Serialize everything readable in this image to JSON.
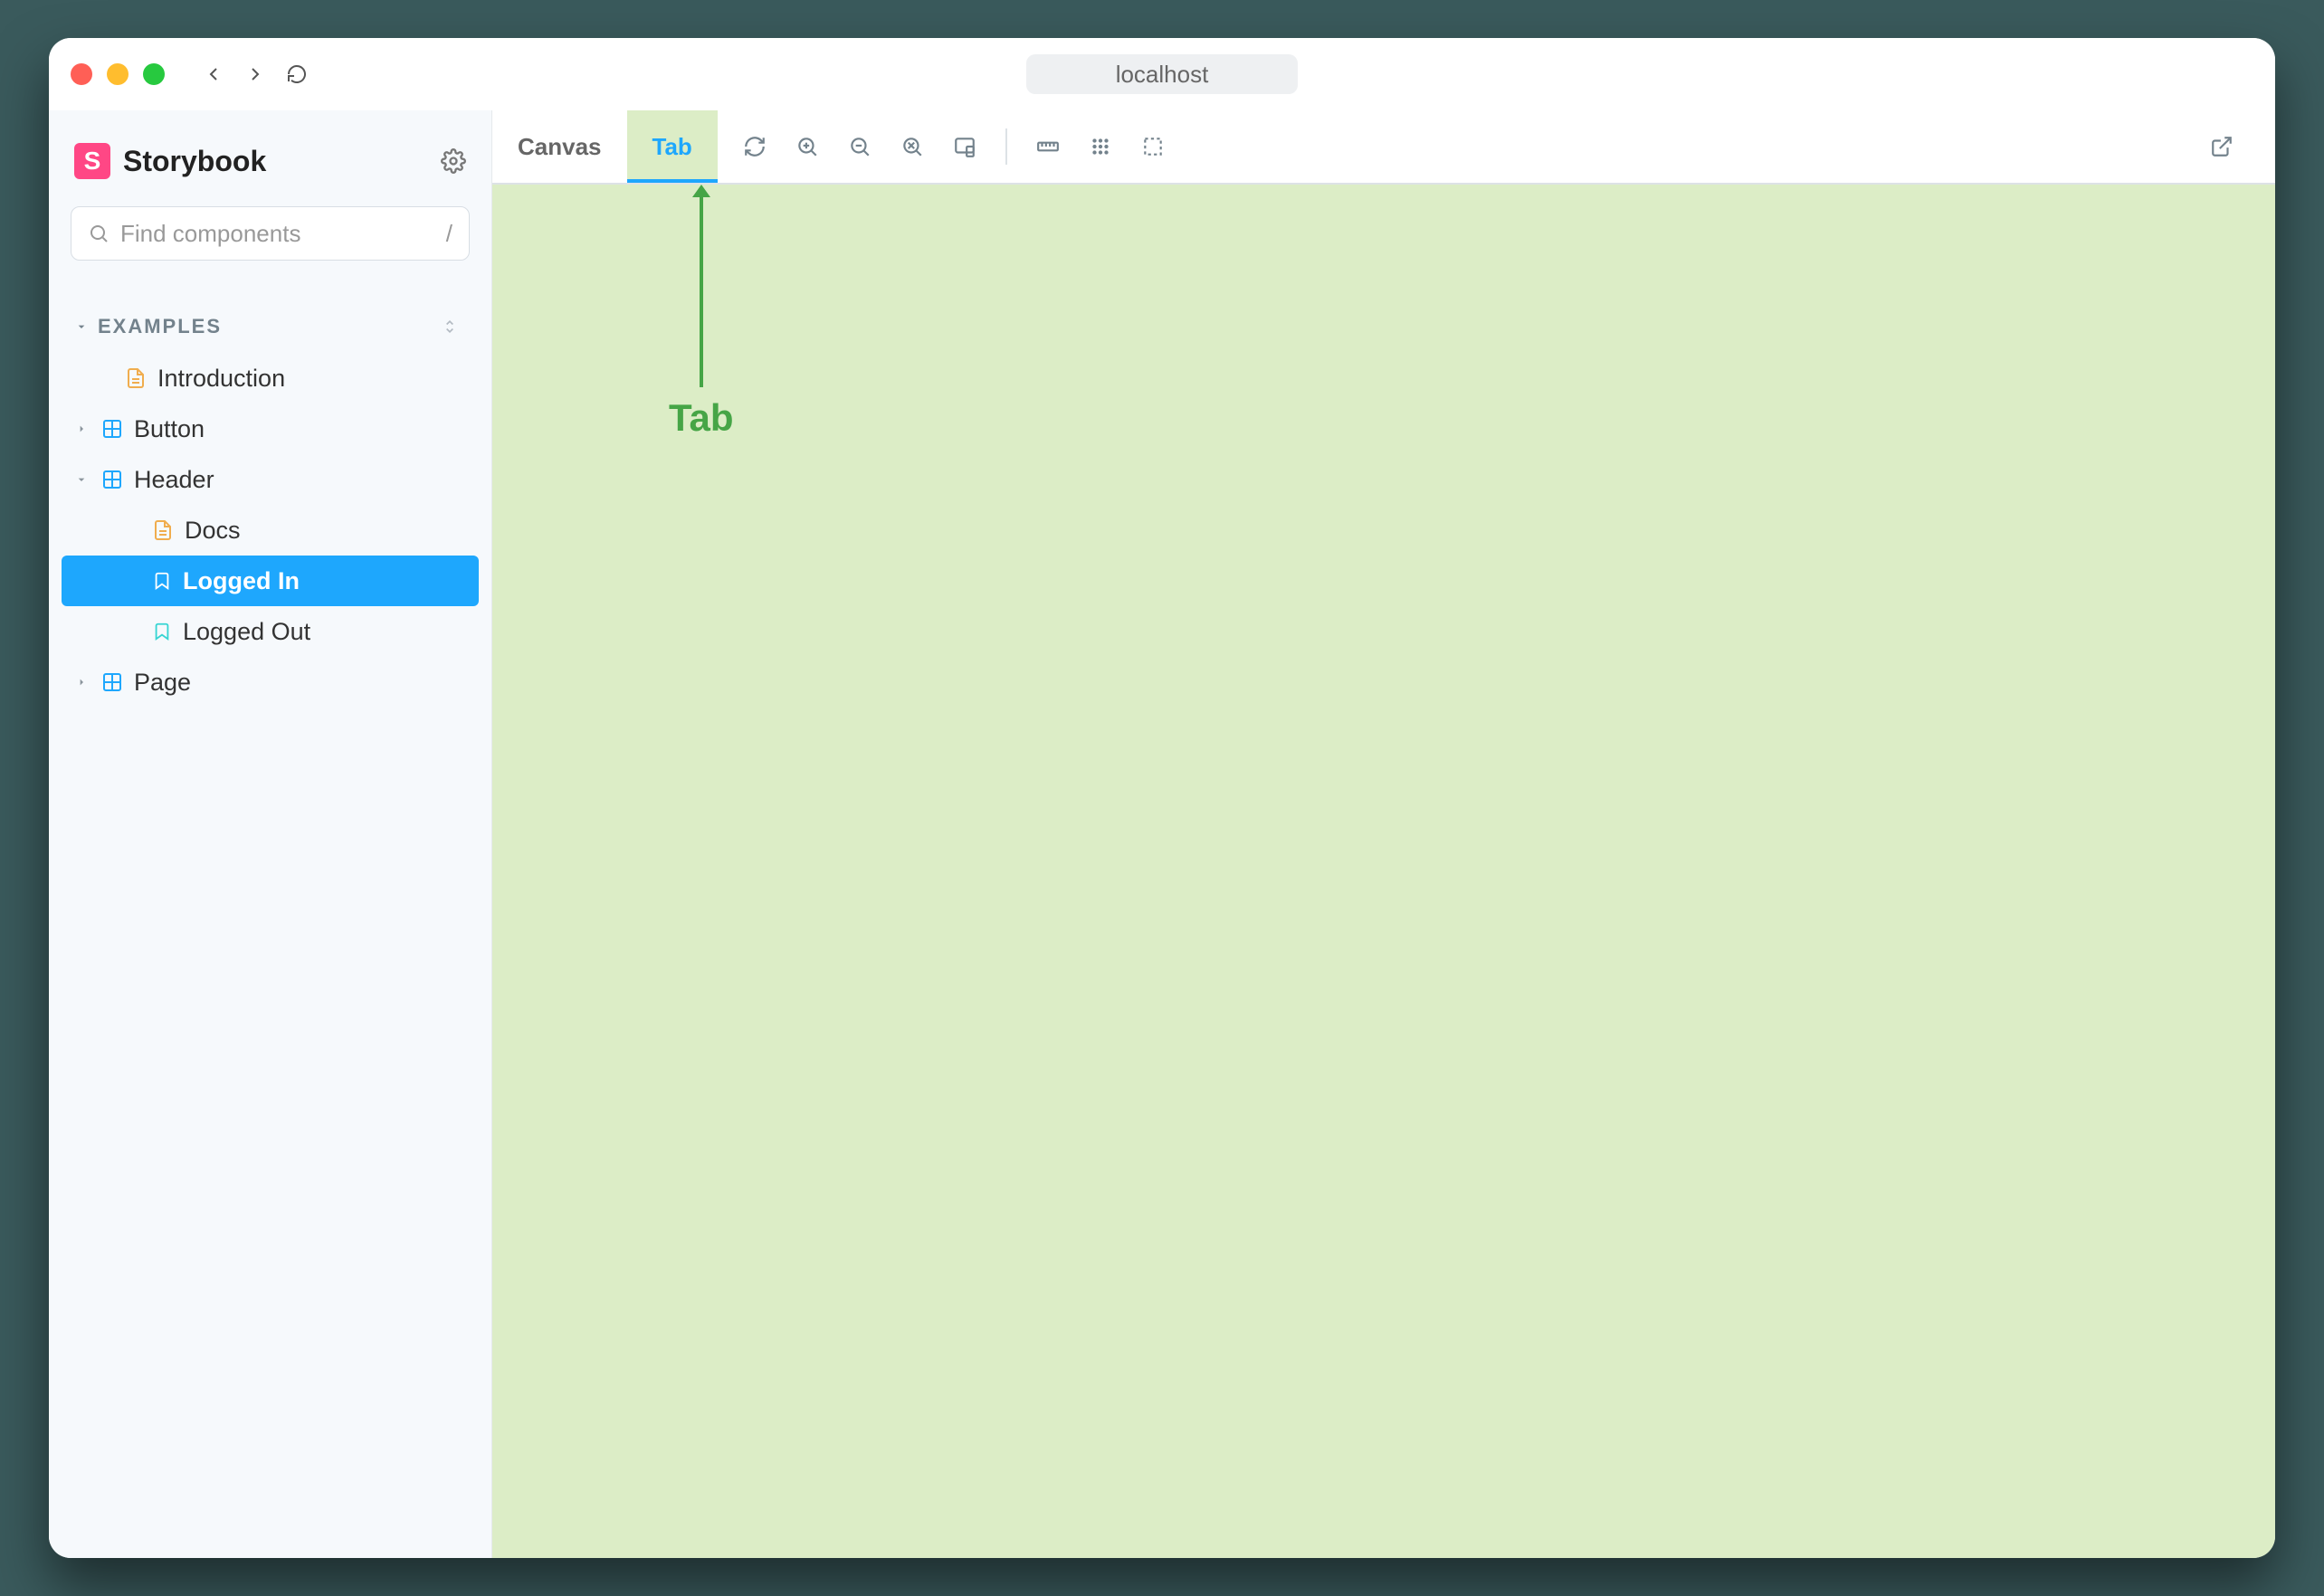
{
  "browser": {
    "address": "localhost"
  },
  "sidebar": {
    "brand": "Storybook",
    "search_placeholder": "Find components",
    "search_shortcut": "/",
    "section_label": "EXAMPLES",
    "items": [
      {
        "label": "Introduction"
      },
      {
        "label": "Button"
      },
      {
        "label": "Header"
      },
      {
        "label": "Docs"
      },
      {
        "label": "Logged In"
      },
      {
        "label": "Logged Out"
      },
      {
        "label": "Page"
      }
    ]
  },
  "toolbar": {
    "tabs": [
      {
        "label": "Canvas"
      },
      {
        "label": "Tab"
      }
    ]
  },
  "annotation": {
    "label": "Tab"
  }
}
